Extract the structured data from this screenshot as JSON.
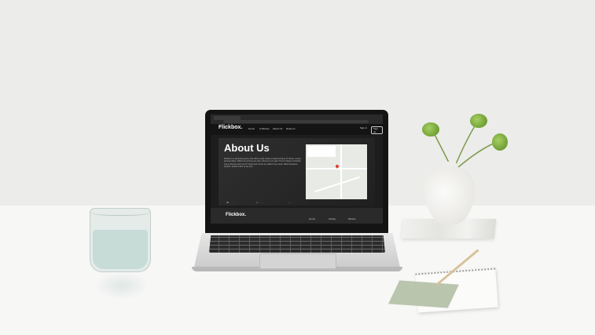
{
  "site": {
    "brand": "Flickbox.",
    "nav": [
      "Home",
      "A-Movies",
      "About Us",
      "News us"
    ],
    "actions": {
      "signin": "Sign in",
      "signup": "Sign up"
    },
    "page_title": "About Us",
    "body_text": "Flickbox is a streaming service that offers a wide variety of award-winning TV shows, movies, documentaries. Watch as much as you want, whenever you want. There's always something new to discover and new TV shows and movies are added every week. Watch anywhere, anytime. Cancel online at any time.",
    "footer_brand": "Flickbox.",
    "footer_links": [
      "Home",
      "Library",
      "Movies"
    ]
  },
  "colors": {
    "site_background": "#1d1d1d",
    "nav_background": "#141414",
    "footer_background": "#2a2a2a",
    "map_pin": "#e53935",
    "wall": "#ececea",
    "desk": "#f7f7f6",
    "foliage": "#7fae3e"
  }
}
